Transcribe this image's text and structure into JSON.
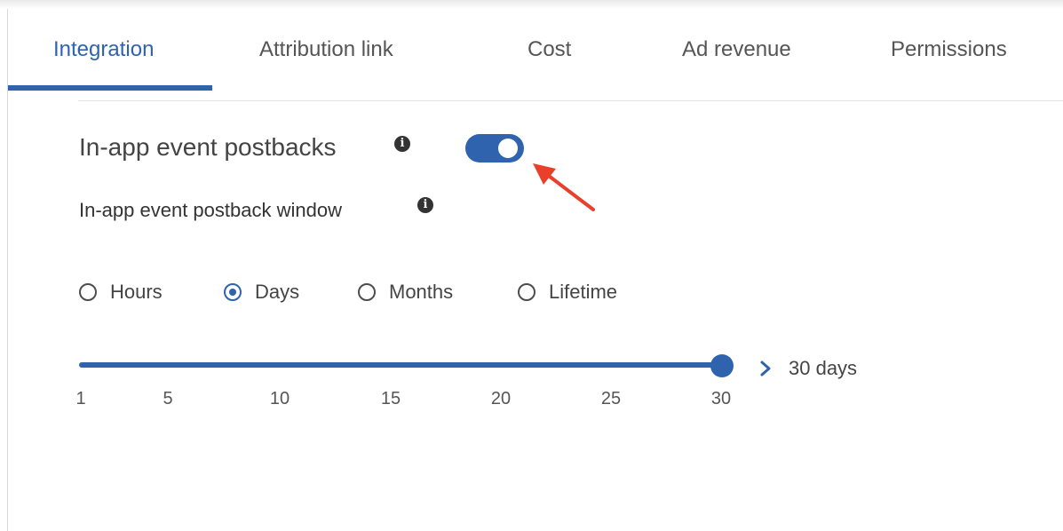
{
  "tabs": [
    {
      "label": "Integration",
      "active": true
    },
    {
      "label": "Attribution link",
      "active": false
    },
    {
      "label": "Cost",
      "active": false
    },
    {
      "label": "Ad revenue",
      "active": false
    },
    {
      "label": "Permissions",
      "active": false
    }
  ],
  "postbacks": {
    "label": "In-app event postbacks",
    "enabled": true,
    "info_glyph": "i"
  },
  "window": {
    "label": "In-app event postback window",
    "info_glyph": "i",
    "options": [
      {
        "label": "Hours",
        "selected": false
      },
      {
        "label": "Days",
        "selected": true
      },
      {
        "label": "Months",
        "selected": false
      },
      {
        "label": "Lifetime",
        "selected": false
      }
    ]
  },
  "slider": {
    "min": 1,
    "max": 30,
    "value": 30,
    "ticks": [
      "1",
      "5",
      "10",
      "15",
      "20",
      "25",
      "30"
    ],
    "value_label": "30 days"
  },
  "colors": {
    "accent": "#2f63ae",
    "annotation_arrow": "#e8402a"
  },
  "icons": {
    "info": "info-icon",
    "chevron": "chevron-right-icon",
    "annotation": "red-arrow-annotation"
  }
}
